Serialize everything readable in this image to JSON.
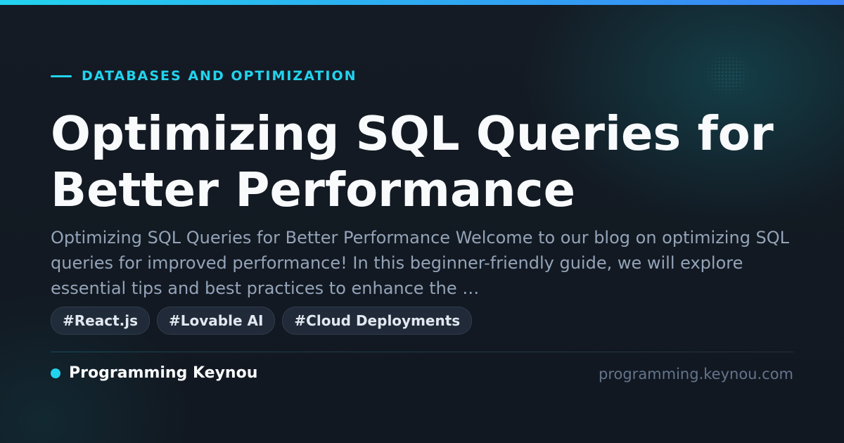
{
  "category": "DATABASES AND OPTIMIZATION",
  "title": "Optimizing SQL Queries for Better Performance",
  "excerpt": "Optimizing SQL Queries for Better Performance Welcome to our blog on optimizing SQL queries for improved performance! In this beginner-friendly guide, we will explore essential tips and best practices to enhance the …",
  "tags": [
    {
      "label": "#React.js"
    },
    {
      "label": "#Lovable AI"
    },
    {
      "label": "#Cloud Deployments"
    }
  ],
  "footer": {
    "brand_name": "Programming Keynou",
    "domain": "programming.keynou.com"
  },
  "colors": {
    "accent": "#22d3ee",
    "background": "#131922",
    "title": "#f8fafc",
    "excerpt": "#94a3b8"
  }
}
